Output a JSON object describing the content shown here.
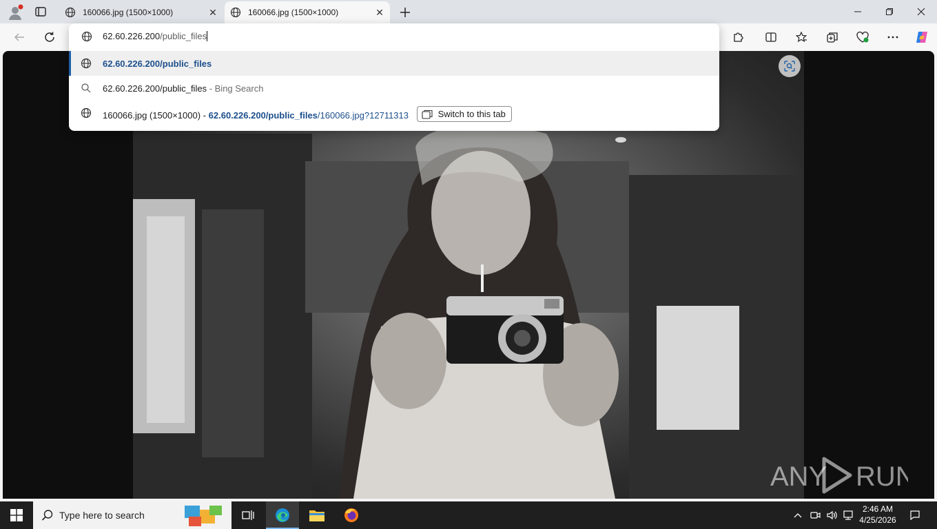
{
  "browser": {
    "tabs": [
      {
        "title": "160066.jpg (1500×1000)",
        "active": false,
        "icon": "globe-icon"
      },
      {
        "title": "160066.jpg (1500×1000)",
        "active": true,
        "icon": "globe-icon"
      }
    ],
    "new_tab_icon": "plus-icon",
    "toolbar_icons": [
      "back-icon",
      "refresh-icon",
      "extensions-icon",
      "split-screen-icon",
      "favorites-icon",
      "collections-icon",
      "browser-essentials-icon",
      "more-icon",
      "copilot-icon"
    ]
  },
  "omnibox": {
    "host": "62.60.226.200",
    "path": "/public_files",
    "suggestions": [
      {
        "icon": "globe-icon",
        "text": "62.60.226.200/public_files",
        "selected": true
      },
      {
        "icon": "search-icon",
        "text": "62.60.226.200/public_files",
        "suffix": "- Bing Search"
      },
      {
        "icon": "globe-icon",
        "title": "160066.jpg (1500×1000)",
        "sep": "-",
        "url_bold": "62.60.226.200/public_files",
        "url_rest": "/160066.jpg?12711313",
        "action": "Switch to this tab"
      }
    ]
  },
  "watermark": {
    "text": "ANY RUN"
  },
  "taskbar": {
    "search_placeholder": "Type here to search",
    "apps": [
      "task-view-icon",
      "edge-icon",
      "file-explorer-icon",
      "firefox-icon"
    ],
    "tray_icons": [
      "chevron-up-icon",
      "meet-now-icon",
      "volume-icon",
      "network-icon",
      "notification-icon"
    ],
    "time": "2:46 AM",
    "date": "4/25/2026"
  },
  "colors": {
    "accent": "#1f5fa8",
    "link": "#1c4f8c",
    "taskbar": "#1f1f1f"
  }
}
